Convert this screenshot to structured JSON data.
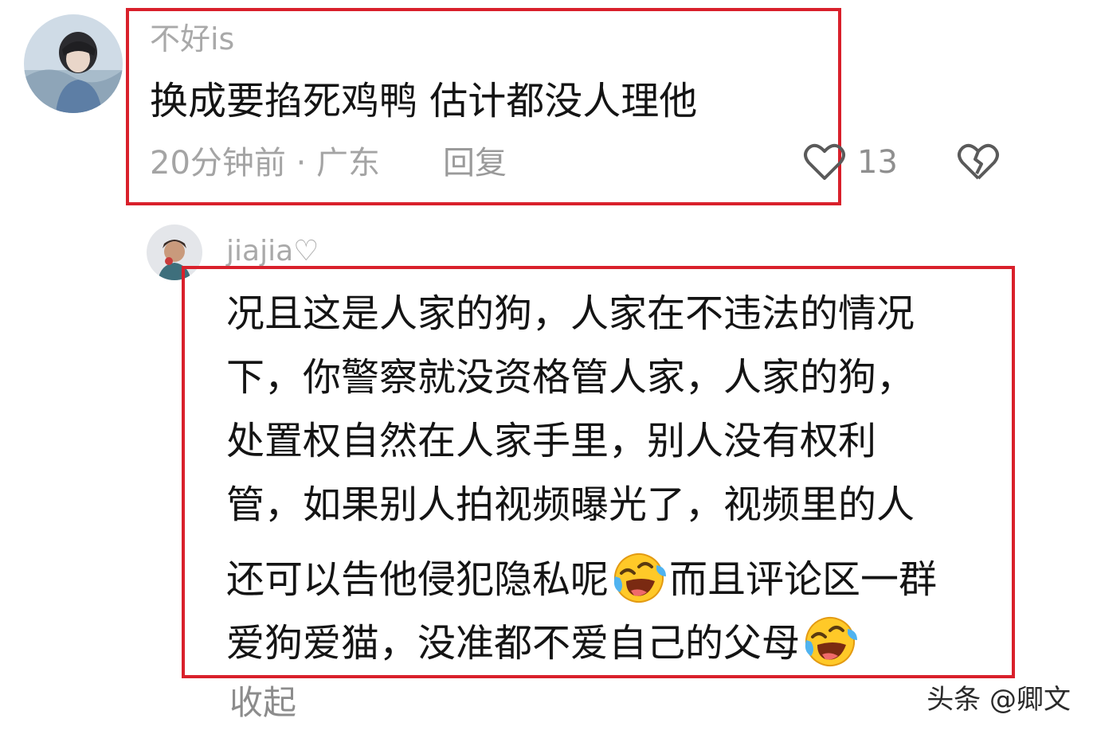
{
  "comment": {
    "username": "不好is",
    "text": "换成要掐死鸡鸭 估计都没人理他",
    "time_location": "20分钟前 · 广东",
    "reply_label": "回复",
    "like_count": "13",
    "avatar_icon": "user-avatar-boy"
  },
  "reply": {
    "username": "jiajia♡",
    "avatar_icon": "user-avatar-girl",
    "lines": [
      "况且这是人家的狗，人家在不违法的情况",
      "下，你警察就没资格管人家，人家的狗，",
      "处置权自然在人家手里，别人没有权利",
      "管，如果别人拍视频曝光了，视频里的人",
      "还可以告他侵犯隐私呢",
      "而且评论区一群",
      "爱狗爱猫，没准都不爱自己的父母"
    ],
    "emoji": "laughing-crying-emoji"
  },
  "collapse_label": "收起",
  "watermark": "头条 @卿文",
  "colors": {
    "highlight": "#d9202b",
    "muted_text": "#a4a4a4",
    "body_text": "#141414"
  }
}
